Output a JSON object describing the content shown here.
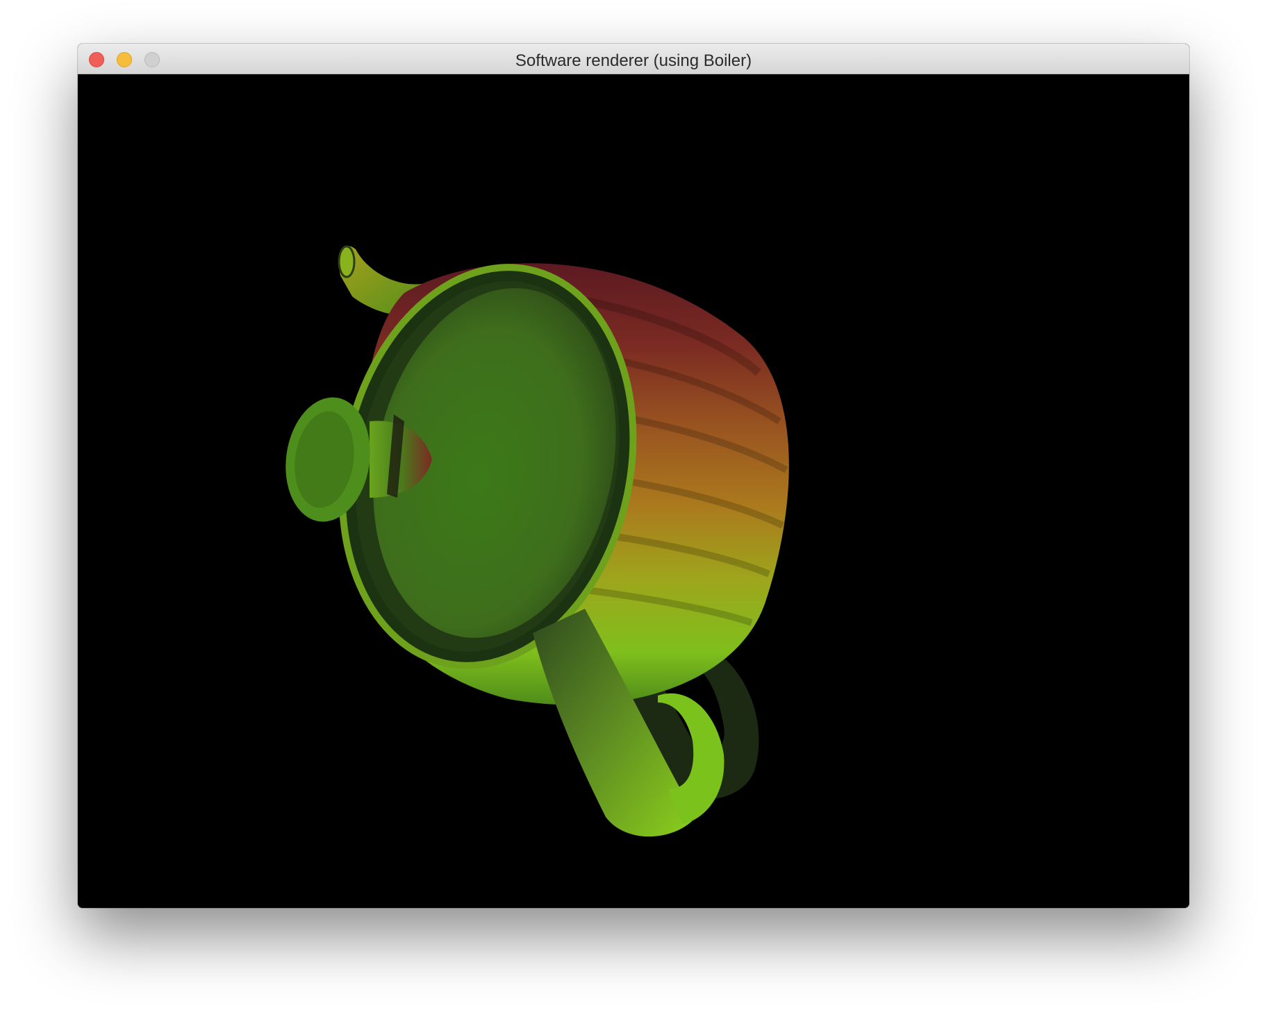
{
  "window": {
    "title": "Software renderer (using Boiler)"
  },
  "titlebar": {
    "buttons": [
      {
        "name": "close",
        "color": "#ee5f57"
      },
      {
        "name": "minimize",
        "color": "#f6bd3b"
      },
      {
        "name": "zoom",
        "color": "#d0d0d0"
      }
    ]
  },
  "viewport": {
    "background": "#000000",
    "render_subject": "teapot-mesh",
    "palette": {
      "body_top": "#6f1d24",
      "body_mid": "#b0791c",
      "body_bottom": "#8ab81c",
      "lid": "#3f7a1a",
      "handle": "#4a7a22"
    }
  }
}
